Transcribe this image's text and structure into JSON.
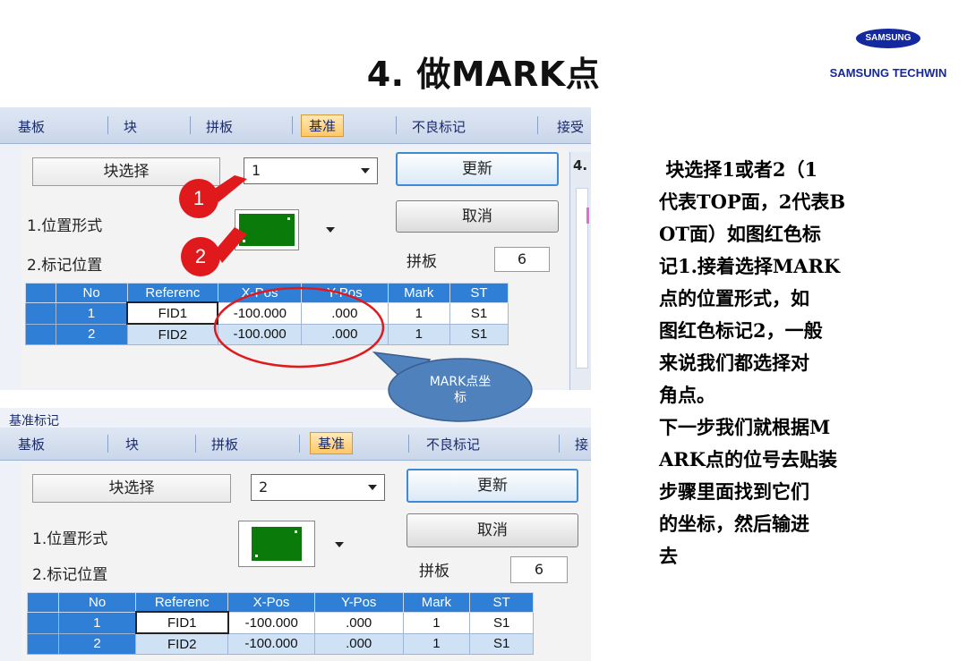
{
  "header": {
    "title": "4. 做MARK点",
    "logo_pill": "SAMSUNG",
    "logo_text": "SAMSUNG TECHWIN"
  },
  "panel_top": {
    "tabs": [
      "基板",
      "块",
      "拼板",
      "基准",
      "不良标记",
      "接受"
    ],
    "side_label": "4.",
    "block_select_label": "块选择",
    "block_select_value": "1",
    "update_button": "更新",
    "cancel_button": "取消",
    "position_format_label": "1.位置形式",
    "mark_position_label": "2.标记位置",
    "panel_label": "拼板",
    "panel_value": "6",
    "table": {
      "headers": [
        "No",
        "Referenc",
        "X-Pos",
        "Y-Pos",
        "Mark",
        "ST"
      ],
      "rows": [
        {
          "no": "1",
          "ref": "FID1",
          "x": "-100.000",
          "y": ".000",
          "mark": "1",
          "st": "S1"
        },
        {
          "no": "2",
          "ref": "FID2",
          "x": "-100.000",
          "y": ".000",
          "mark": "1",
          "st": "S1"
        }
      ]
    }
  },
  "panel_bottom": {
    "window_title": "基准标记",
    "tabs": [
      "基板",
      "块",
      "拼板",
      "基准",
      "不良标记",
      "接"
    ],
    "block_select_label": "块选择",
    "block_select_value": "2",
    "update_button": "更新",
    "cancel_button": "取消",
    "position_format_label": "1.位置形式",
    "mark_position_label": "2.标记位置",
    "panel_label": "拼板",
    "panel_value": "6",
    "table": {
      "headers": [
        "No",
        "Referenc",
        "X-Pos",
        "Y-Pos",
        "Mark",
        "ST"
      ],
      "rows": [
        {
          "no": "1",
          "ref": "FID1",
          "x": "-100.000",
          "y": ".000",
          "mark": "1",
          "st": "S1"
        },
        {
          "no": "2",
          "ref": "FID2",
          "x": "-100.000",
          "y": ".000",
          "mark": "1",
          "st": "S1"
        }
      ]
    }
  },
  "annotations": {
    "badge1": "1",
    "badge2": "2",
    "callout": "MARK点坐\n标"
  },
  "description": " 块选择1或者2（1\n代表TOP面，2代表B\nOT面）如图红色标\n记1.接着选择MARK\n点的位置形式，如\n图红色标记2，一般\n来说我们都选择对\n角点。\n下一步我们就根据M\nARK点的位号去贴装\n步骤里面找到它们\n的坐标，然后输进\n去",
  "colors": {
    "logo_blue": "#1428a0",
    "badge_red": "#e0191c",
    "grid_header_blue": "#2f7fd6",
    "swatch_green": "#0a7a0a",
    "callout_fill": "#4f81bd"
  }
}
